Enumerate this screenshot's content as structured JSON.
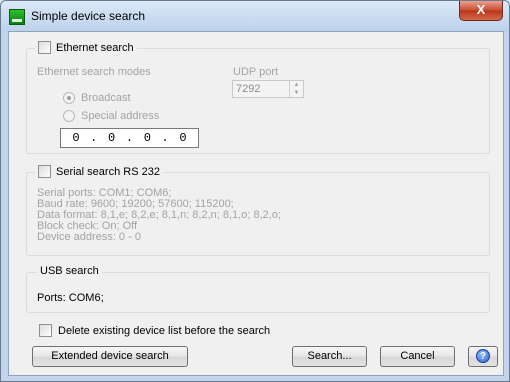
{
  "window": {
    "title": "Simple device search",
    "close_glyph": "X"
  },
  "ethernet": {
    "legend": "Ethernet search",
    "modes_label": "Ethernet search modes",
    "udp_label": "UDP port",
    "udp_value": "7292",
    "broadcast_label": "Broadcast",
    "special_label": "Special address",
    "selected_mode": "Broadcast",
    "ip_octets": [
      "0",
      "0",
      "0",
      "0"
    ],
    "checked": false
  },
  "serial": {
    "legend": "Serial search RS 232",
    "checked": false,
    "info": [
      "Serial ports: COM1; COM6;",
      "Baud rate: 9600; 19200; 57600; 115200;",
      "Data format: 8,1,e; 8,2,e; 8,1,n; 8,2,n; 8,1,o; 8,2,o;",
      "Block check: On; Off",
      "Device address: 0 - 0"
    ]
  },
  "usb": {
    "legend": "USB search",
    "ports": "Ports: COM6;"
  },
  "delete_list": {
    "label": "Delete existing device list before the search",
    "checked": false
  },
  "buttons": {
    "extended": "Extended device search",
    "search": "Search...",
    "cancel": "Cancel",
    "help_glyph": "?"
  }
}
